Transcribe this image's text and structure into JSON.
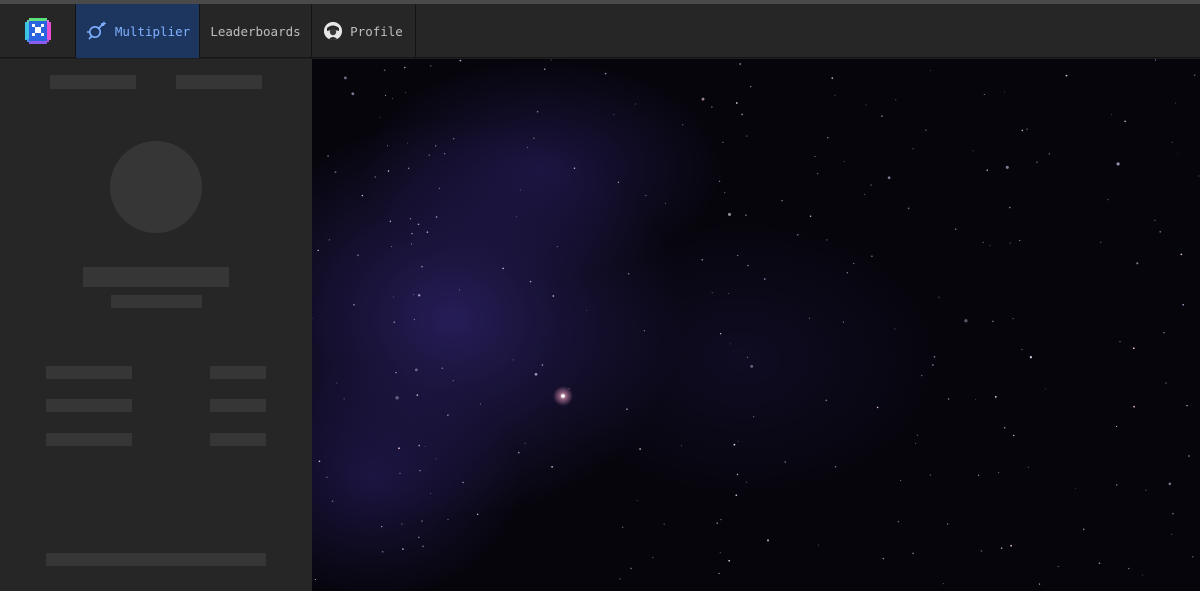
{
  "nav": {
    "tabs": [
      {
        "label": "Multiplier",
        "icon": "rocket-icon",
        "active": true
      },
      {
        "label": "Leaderboards",
        "active": false
      },
      {
        "label": "Profile",
        "icon": "avatar-icon",
        "active": false
      }
    ]
  },
  "colors": {
    "accent": "#7fb0ff",
    "active_tab_bg": "#1d3660",
    "panel_bg": "#262626",
    "skeleton": "#363636",
    "space_bg": "#06050c",
    "nebula": "#2b2164"
  }
}
